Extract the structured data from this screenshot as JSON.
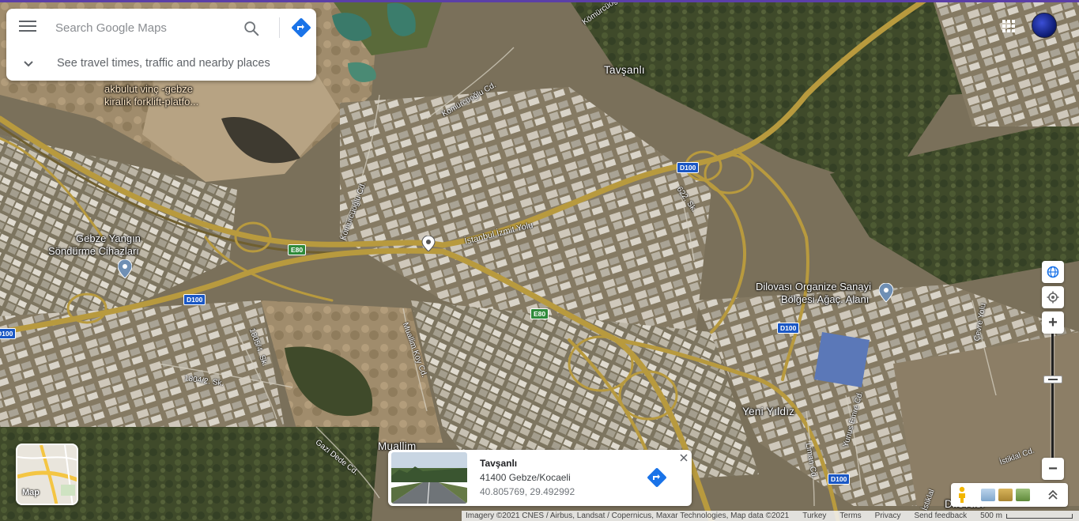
{
  "search": {
    "placeholder": "Search Google Maps",
    "travel_prompt": "See travel times, traffic and nearby places"
  },
  "map": {
    "place_labels": {
      "tavsanli": "Tavşanlı",
      "akbulut_line1": "akbulut vinç -gebze",
      "akbulut_line2": "kiralık forklift-platfo...",
      "gebze_line1": "Gebze Yangın",
      "gebze_line2": "Söndürme Cihazları",
      "dilovasi_line1": "Dilovası Organize Sanayi",
      "dilovasi_line2": "Bölgesi Ağaç. Alanı",
      "yeni_yildiz": "Yeni Yıldız",
      "muallim": "Muallim",
      "dilovasi": "Dilovası"
    },
    "road_labels": {
      "istanbul_izmit": "İstanbul İzmit Yolu",
      "komurcuoglu_1": "Komürcüoğlu Cd.",
      "komurcuoglu_2": "Kömürcüoğlu Cd.",
      "komurcuoglu_3": "Kömürcüoğlu Cd.",
      "road_622": "622. Sk.",
      "muallim_koy": "Muallim Köy Cd.",
      "road_1805": "1805/4. Sk.",
      "road_1804": "1804/2. Sk.",
      "gazi_dede": "Gazi Dede Cd.",
      "liman": "Liman Cd.",
      "yunus_emre": "Yunus Emre Cd.",
      "cevre": "Çevre Yolu",
      "istiklal": "İstiklal Cd.",
      "istiklal_2": "İstiklal"
    },
    "shields": {
      "d100_a": "D100",
      "d100_b": "D100",
      "d100_c": "D100",
      "d100_d": "D100",
      "d100_e": "D100",
      "e80_a": "E80",
      "e80_b": "E80"
    }
  },
  "layer_toggle": {
    "label": "Map"
  },
  "info_card": {
    "title": "Tavşanlı",
    "address": "41400 Gebze/Kocaeli",
    "coords": "40.805769, 29.492992"
  },
  "zoom": {
    "in_label": "+",
    "out_label": "−"
  },
  "attribution": {
    "imagery": "Imagery ©2021 CNES / Airbus, Landsat / Copernicus, Maxar Technologies, Map data ©2021",
    "country": "Turkey",
    "terms": "Terms",
    "privacy": "Privacy",
    "feedback": "Send feedback",
    "scale": "500 m"
  },
  "colors": {
    "accent": "#5b3fa8",
    "directions_blue": "#1a73e8",
    "highway_shield_blue": "#1a57c4",
    "highway_shield_green": "#2f8a3a",
    "road_yellow": "#b89a3e"
  },
  "icons": {
    "menu": "menu-icon",
    "search": "search-icon",
    "directions": "directions-icon",
    "apps": "apps-grid-icon",
    "globe": "globe-icon",
    "location": "my-location-icon",
    "pegman": "pegman-icon"
  }
}
